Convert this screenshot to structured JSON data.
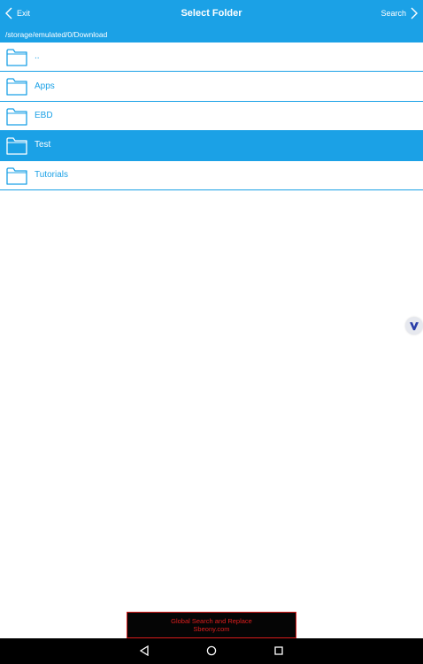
{
  "header": {
    "back_label": "Exit",
    "title": "Select Folder",
    "search_label": "Search",
    "path": "/storage/emulated/0/Download"
  },
  "folders": [
    {
      "name": "..",
      "selected": false
    },
    {
      "name": "Apps",
      "selected": false
    },
    {
      "name": "EBD",
      "selected": false
    },
    {
      "name": "Test",
      "selected": true
    },
    {
      "name": "Tutorials",
      "selected": false
    }
  ],
  "floating_button": {
    "icon": "v-logo-icon"
  },
  "ad": {
    "line1": "Global Search and Replace",
    "line2": "Sbeony.com"
  },
  "system_nav": {
    "back": "nav-back-icon",
    "home": "nav-home-icon",
    "recents": "nav-recents-icon"
  },
  "colors": {
    "accent": "#1ba1e6",
    "selected_text": "#ffffff",
    "ad_text": "#e01e1e",
    "ad_background": "#050505",
    "navbar": "#000000"
  }
}
